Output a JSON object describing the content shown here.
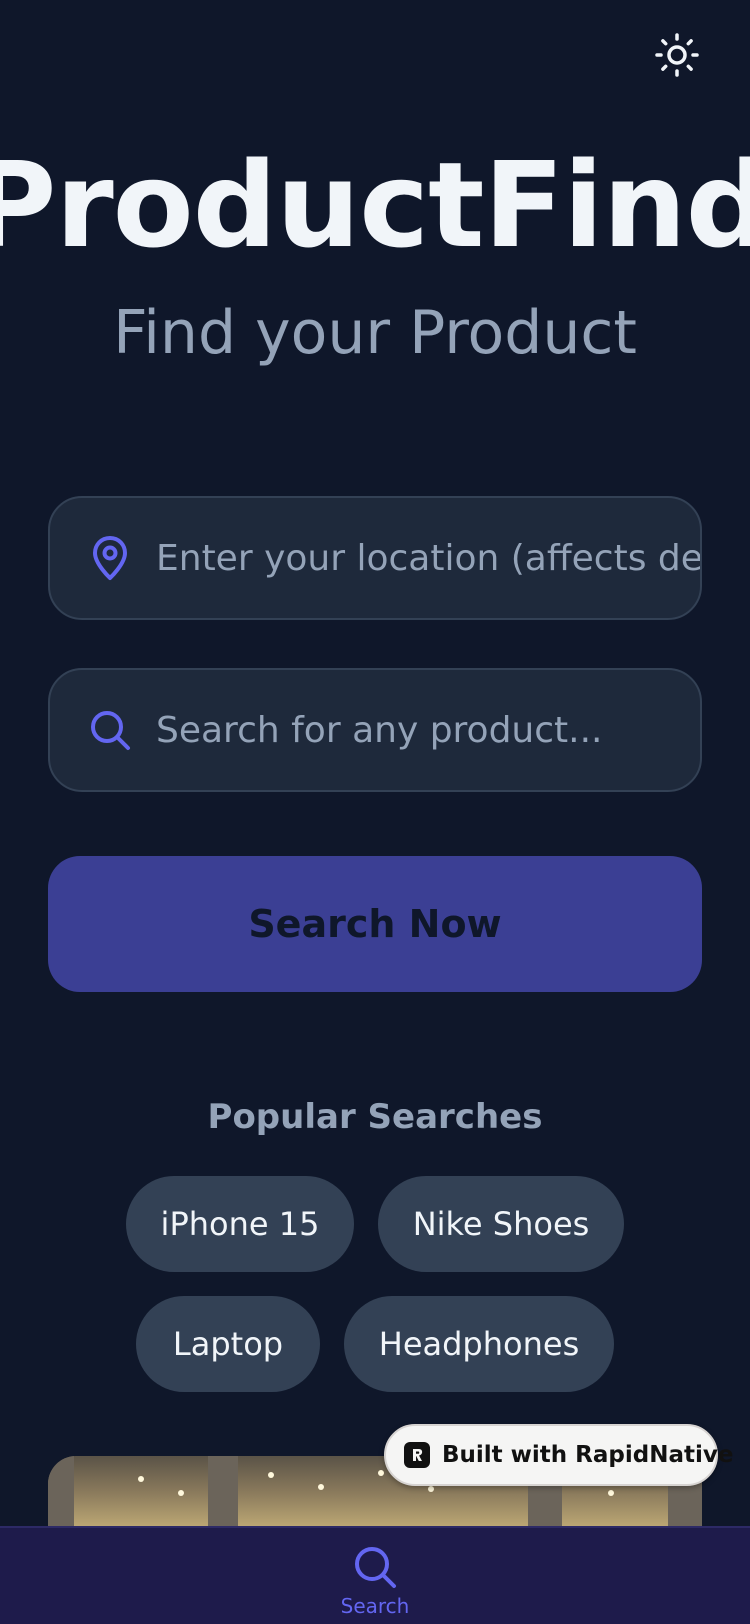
{
  "header": {
    "theme_toggle_icon": "sun-icon",
    "title": "ProductFinder",
    "subtitle": "Find your Product"
  },
  "location_field": {
    "icon": "map-pin-icon",
    "value": "",
    "placeholder": "Enter your location (affects delivery)"
  },
  "search_field": {
    "icon": "search-icon",
    "value": "",
    "placeholder": "Search for any product..."
  },
  "search_button": {
    "label": "Search Now"
  },
  "popular": {
    "heading": "Popular Searches",
    "items": [
      {
        "label": "iPhone 15"
      },
      {
        "label": "Nike Shoes"
      },
      {
        "label": "Laptop"
      },
      {
        "label": "Headphones"
      }
    ]
  },
  "badge": {
    "label": "Built with RapidNative",
    "icon": "rapidnative-logo-icon"
  },
  "tab_bar": {
    "items": [
      {
        "label": "Search",
        "icon": "search-icon",
        "active": true
      }
    ]
  },
  "colors": {
    "background": "#0f172a",
    "field_background": "#1e293b",
    "accent": "#6366f1",
    "button": "#3b3f94",
    "chip": "#334155",
    "tab_bar": "#1e1b4b"
  }
}
